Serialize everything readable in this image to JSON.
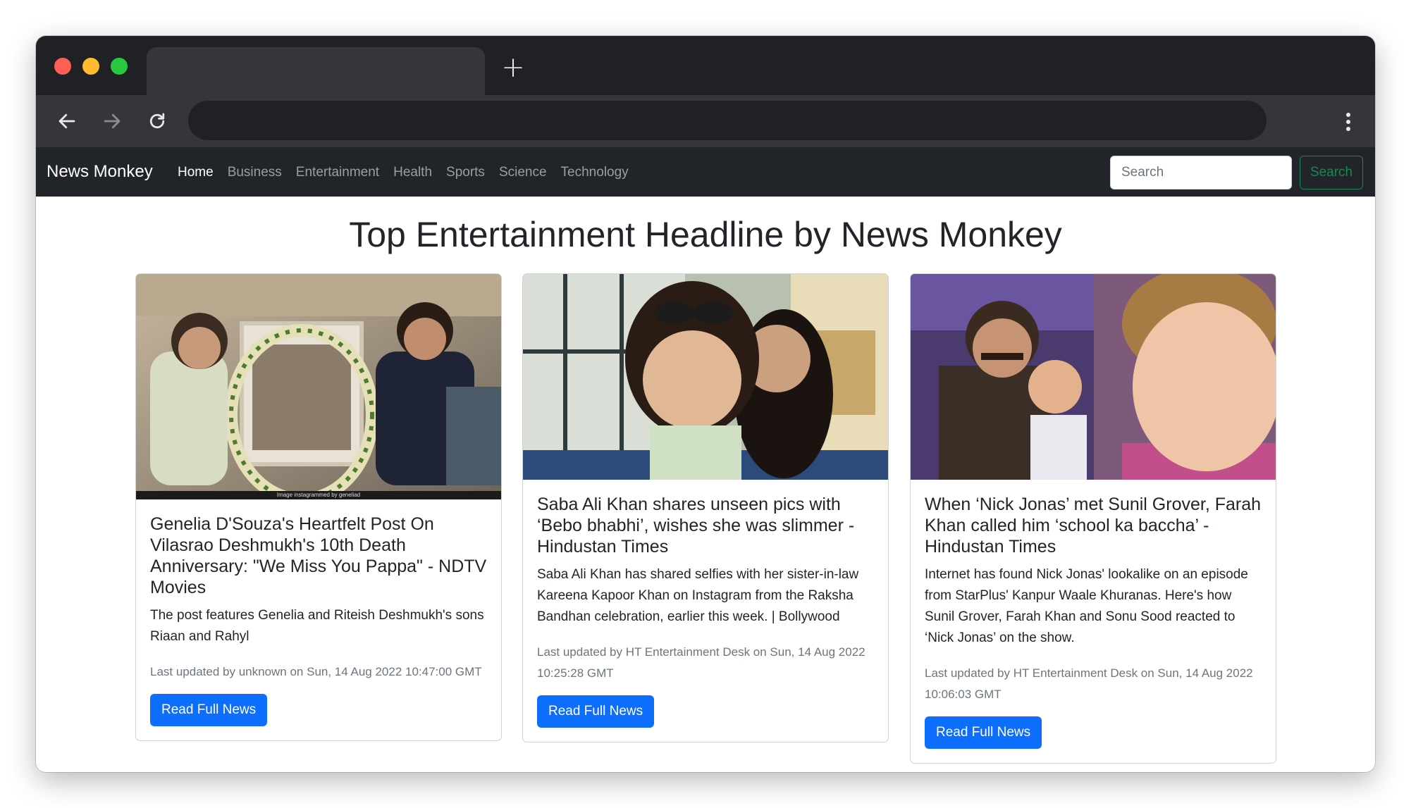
{
  "browser": {
    "new_tab_symbol": "+"
  },
  "navbar": {
    "brand": "News Monkey",
    "links": [
      "Home",
      "Business",
      "Entertainment",
      "Health",
      "Sports",
      "Science",
      "Technology"
    ],
    "active": "Home",
    "search_placeholder": "Search",
    "search_button": "Search"
  },
  "page": {
    "title": "Top Entertainment Headline by News Monkey"
  },
  "cards": [
    {
      "title": "Genelia D'Souza's Heartfelt Post On Vilasrao Deshmukh's 10th Death Anniversary: \"We Miss You Pappa\" - NDTV Movies",
      "description": "The post features Genelia and Riteish Deshmukh's sons Riaan and Rahyl",
      "meta": "Last updated by unknown on Sun, 14 Aug 2022 10:47:00 GMT",
      "button": "Read Full News",
      "image_caption": "Image instagrammed by geneliad"
    },
    {
      "title": "Saba Ali Khan shares unseen pics with ‘Bebo bhabhi’, wishes she was slimmer - Hindustan Times",
      "description": "Saba Ali Khan has shared selfies with her sister-in-law Kareena Kapoor Khan on Instagram from the Raksha Bandhan celebration, earlier this week. | Bollywood",
      "meta": "Last updated by HT Entertainment Desk on Sun, 14 Aug 2022 10:25:28 GMT",
      "button": "Read Full News"
    },
    {
      "title": "When ‘Nick Jonas’ met Sunil Grover, Farah Khan called him ‘school ka baccha’ - Hindustan Times",
      "description": "Internet has found Nick Jonas' lookalike on an episode from StarPlus' Kanpur Waale Khuranas. Here's how Sunil Grover, Farah Khan and Sonu Sood reacted to ‘Nick Jonas’ on the show.",
      "meta": "Last updated by HT Entertainment Desk on Sun, 14 Aug 2022 10:06:03 GMT",
      "button": "Read Full News"
    }
  ],
  "colors": {
    "navbar_bg": "#212529",
    "primary": "#0d6efd",
    "success": "#198754"
  }
}
